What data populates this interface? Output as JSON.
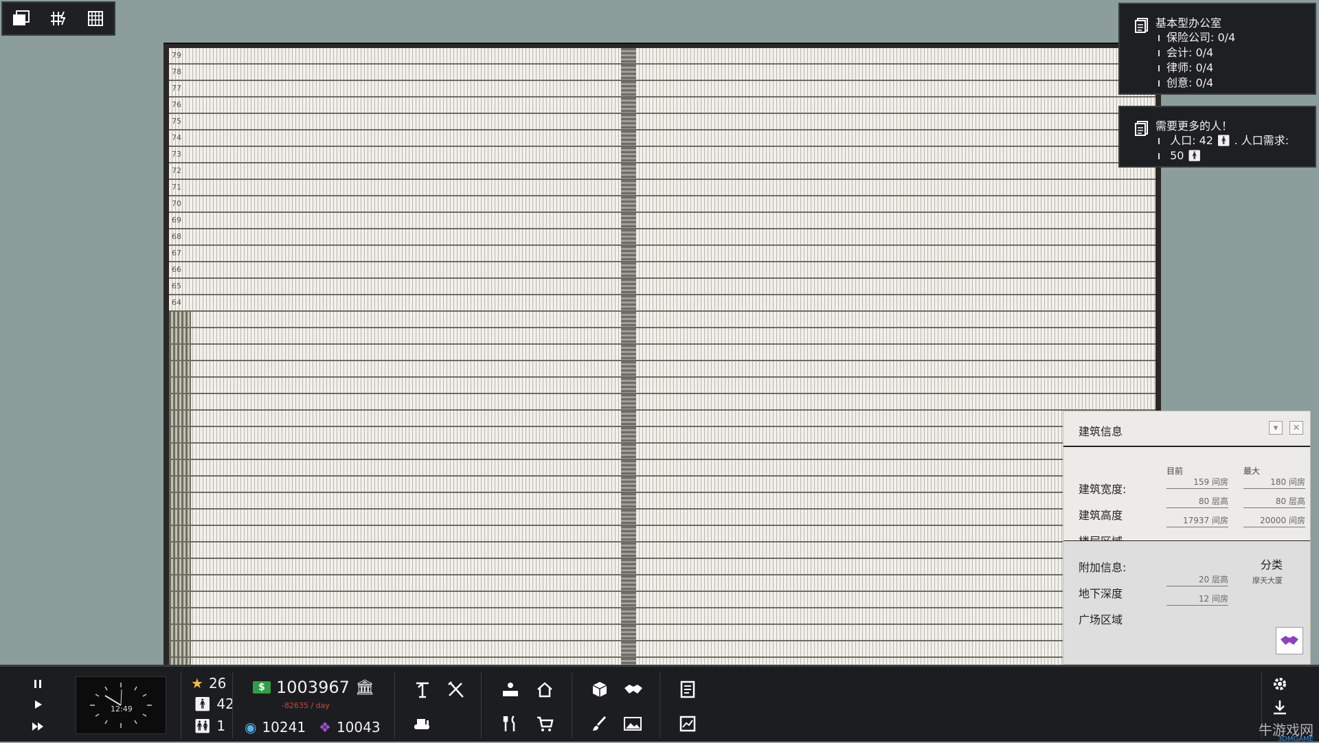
{
  "top_toolbar": {
    "icons": [
      "window-copy-icon",
      "grid-power-icon",
      "building-icon"
    ]
  },
  "building": {
    "upper_floors": [
      "79",
      "78",
      "77",
      "76",
      "75",
      "74",
      "73",
      "72",
      "71",
      "70",
      "69",
      "68",
      "67",
      "66",
      "65",
      "64"
    ],
    "lower_floor_count": 22
  },
  "notices": {
    "office": {
      "title": "基本型办公室",
      "items": [
        "保险公司: 0/4",
        "会计: 0/4",
        "律师: 0/4",
        "创意: 0/4"
      ]
    },
    "population": {
      "title": "需要更多的人！",
      "line1": "人口: 42",
      "line1_suffix": ". 人口需求:",
      "line2": "50"
    }
  },
  "info_panel": {
    "title": "建筑信息",
    "col_current": "目前",
    "col_max": "最大",
    "width_label": "建筑宽度:",
    "width_current": "159 间房",
    "width_max": "180 间房",
    "height_label": "建筑高度",
    "height_current": "80 层高",
    "height_max": "80 层高",
    "floor_area_label": "楼层区域",
    "floor_area_current": "17937 间房",
    "floor_area_max": "20000 间房",
    "extra_label": "附加信息:",
    "underground_label": "地下深度",
    "underground_value": "20 层高",
    "plaza_label": "广场区域",
    "plaza_value": "12 间房",
    "class_label": "分类",
    "class_value": "摩天大厦"
  },
  "bottom_bar": {
    "clock_time": "12:49",
    "stars": "26",
    "population": "42",
    "workers": "1",
    "money": "1003967",
    "daily": "-82635 / day",
    "eco": "10241",
    "partnership": "10043"
  },
  "watermark": {
    "text": "牛游戏网",
    "sub": "3DMGAME"
  }
}
